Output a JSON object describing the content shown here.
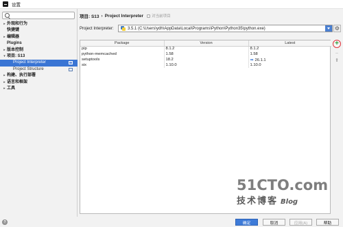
{
  "window": {
    "title": "设置"
  },
  "sidebar": {
    "search_placeholder": "",
    "items": [
      {
        "label": "外观和行为",
        "arrow": "▸",
        "level": 0
      },
      {
        "label": "快捷键",
        "arrow": "",
        "level": 0
      },
      {
        "label": "编辑器",
        "arrow": "▸",
        "level": 0
      },
      {
        "label": "Plugins",
        "arrow": "",
        "level": 0
      },
      {
        "label": "版本控制",
        "arrow": "▸",
        "level": 0
      },
      {
        "label": "项目: S13",
        "arrow": "▾",
        "level": 0
      },
      {
        "label": "Project Interpreter",
        "arrow": "",
        "level": 1,
        "selected": true
      },
      {
        "label": "Project Structure",
        "arrow": "",
        "level": 1
      },
      {
        "label": "构建、执行部署",
        "arrow": "▸",
        "level": 0
      },
      {
        "label": "语言和框架",
        "arrow": "▸",
        "level": 0
      },
      {
        "label": "工具",
        "arrow": "▸",
        "level": 0
      }
    ]
  },
  "breadcrumb": {
    "project": "项目: S13",
    "separator": "›",
    "page": "Project Interpreter",
    "note": "对当前项目"
  },
  "interpreter": {
    "label": "Project Interpreter:",
    "value": "3.5.1 (C:\\Users\\ydh\\AppData\\Local\\Programs\\Python\\Python35\\python.exe)"
  },
  "packages": {
    "columns": [
      "Package",
      "Version",
      "Latest"
    ],
    "rows": [
      {
        "package": "pip",
        "version": "8.1.2",
        "latest": "8.1.2",
        "upgrade": false
      },
      {
        "package": "python-memcached",
        "version": "1.58",
        "latest": "1.58",
        "upgrade": false
      },
      {
        "package": "setuptools",
        "version": "18.2",
        "latest": "26.1.1",
        "upgrade": true
      },
      {
        "package": "six",
        "version": "1.10.0",
        "latest": "1.10.0",
        "upgrade": false
      }
    ]
  },
  "tools": {
    "add": "+",
    "remove": "−",
    "upgrade": "⬆"
  },
  "watermark": {
    "line1": "51CTO.com",
    "line2": "技术博客",
    "blog": "Blog"
  },
  "buttons": {
    "ok": "确定",
    "cancel": "取消",
    "apply": "应用(A)",
    "help": "帮助",
    "help_icon": "?"
  },
  "colors": {
    "selection": "#3a75d4",
    "primary_button": "#3e7bd8",
    "add_ring": "#e0333d",
    "add_plus": "#2e9a37"
  }
}
